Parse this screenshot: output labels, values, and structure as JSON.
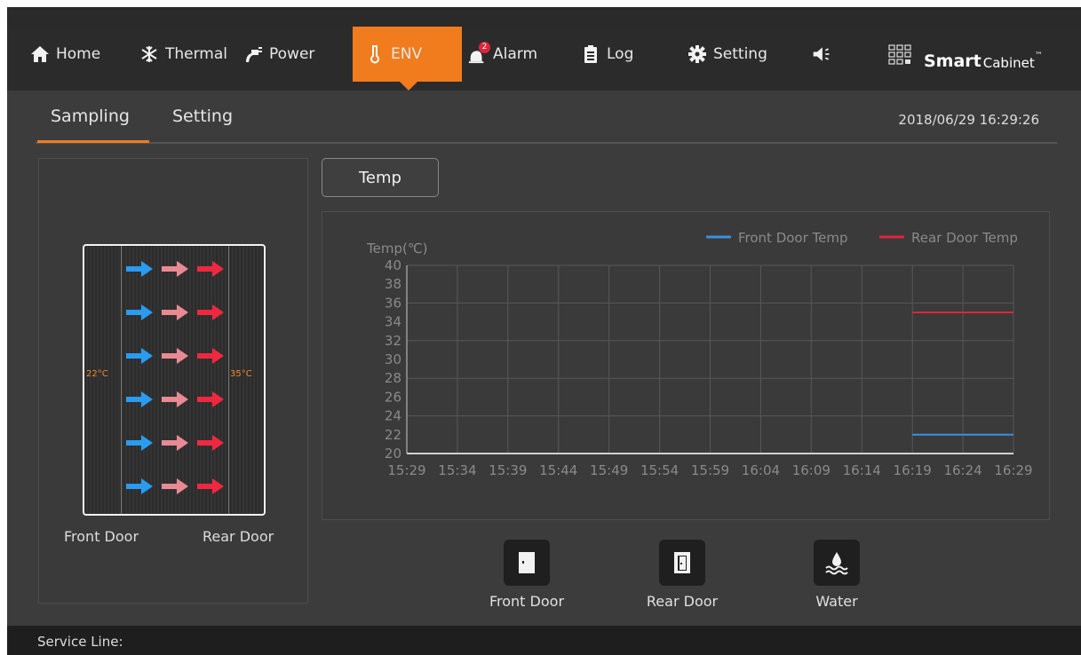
{
  "nav": {
    "items": [
      {
        "label": "Home",
        "icon": "home-icon"
      },
      {
        "label": "Thermal",
        "icon": "snowflake-icon"
      },
      {
        "label": "Power",
        "icon": "power-plug-icon"
      },
      {
        "label": "ENV",
        "icon": "thermometer-icon",
        "active": true
      },
      {
        "label": "Alarm",
        "icon": "alarm-bell-icon",
        "badge": "2"
      },
      {
        "label": "Log",
        "icon": "clipboard-icon"
      },
      {
        "label": "Setting",
        "icon": "gear-icon"
      },
      {
        "label": "",
        "icon": "speaker-icon"
      }
    ],
    "brand_bold": "Smart",
    "brand_light": "Cabinet",
    "brand_tm": "™",
    "accent": "#f07c1e"
  },
  "subtabs": {
    "items": [
      "Sampling",
      "Setting"
    ],
    "active": "Sampling",
    "datetime": "2018/06/29 16:29:26"
  },
  "cabinet": {
    "front_temp": "22°C",
    "rear_temp": "35°C",
    "front_label": "Front Door",
    "rear_label": "Rear Door"
  },
  "chart_controls": {
    "temp_button": "Temp"
  },
  "chart_data": {
    "type": "line",
    "ylabel": "Temp(℃)",
    "ylim": [
      20,
      40
    ],
    "yticks": [
      "40",
      "38",
      "36",
      "34",
      "32",
      "30",
      "28",
      "26",
      "24",
      "22",
      "20"
    ],
    "categories": [
      "15:29",
      "15:34",
      "15:39",
      "15:44",
      "15:49",
      "15:54",
      "15:59",
      "16:04",
      "16:09",
      "16:14",
      "16:19",
      "16:24",
      "16:29"
    ],
    "series": [
      {
        "name": "Front Door Temp",
        "color": "#3b8fe0",
        "points": [
          {
            "x": "16:19",
            "y": 22
          },
          {
            "x": "16:29",
            "y": 22
          }
        ]
      },
      {
        "name": "Rear Door Temp",
        "color": "#e0243a",
        "points": [
          {
            "x": "16:19",
            "y": 35
          },
          {
            "x": "16:29",
            "y": 35
          }
        ]
      }
    ],
    "grid": true,
    "legend": "top-right"
  },
  "sensors": [
    {
      "label": "Front Door",
      "icon": "door-closed-icon"
    },
    {
      "label": "Rear Door",
      "icon": "door-open-icon"
    },
    {
      "label": "Water",
      "icon": "water-leak-icon"
    }
  ],
  "footer": {
    "service_line": "Service Line:"
  }
}
